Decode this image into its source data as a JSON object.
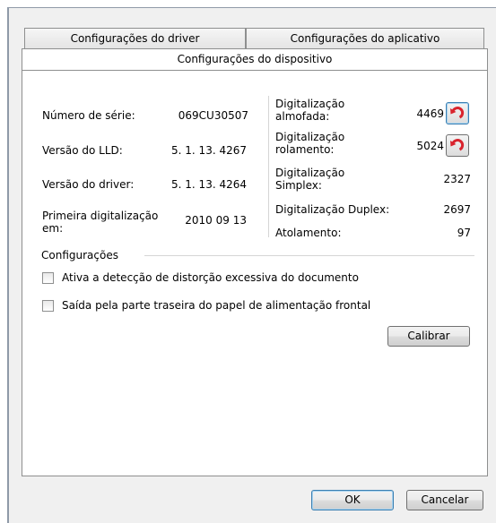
{
  "tabs": {
    "driver": "Configurações do driver",
    "application": "Configurações do aplicativo",
    "device": "Configurações do dispositivo"
  },
  "info": {
    "serial_label": "Número de série:",
    "serial_value": "069CU30507",
    "lld_label": "Versão do LLD:",
    "lld_value": "5. 1. 13. 4267",
    "driver_label": "Versão do driver:",
    "driver_value": "5. 1. 13. 4264",
    "first_scan_label_line1": "Primeira digitalização",
    "first_scan_label_line2": "em:",
    "first_scan_value": "2010 09 13"
  },
  "counters": {
    "pad_label_line1": "Digitalização",
    "pad_label_line2": "almofada:",
    "pad_value": "4469",
    "roller_label_line1": "Digitalização",
    "roller_label_line2": "rolamento:",
    "roller_value": "5024",
    "simplex_label_line1": "Digitalização",
    "simplex_label_line2": "Simplex:",
    "simplex_value": "2327",
    "duplex_label": "Digitalização Duplex:",
    "duplex_value": "2697",
    "jam_label": "Atolamento:",
    "jam_value": "97"
  },
  "settings": {
    "group_title": "Configurações",
    "option1": "Ativa a detecção de distorção excessiva do documento",
    "option2": "Saída pela parte traseira do papel de alimentação frontal",
    "calibrate": "Calibrar"
  },
  "buttons": {
    "ok": "OK",
    "cancel": "Cancelar"
  },
  "icons": {
    "reset": "reset-arrow-icon"
  },
  "colors": {
    "reset_arrow": "#d9232d",
    "focus_border": "#3c7fb1"
  }
}
